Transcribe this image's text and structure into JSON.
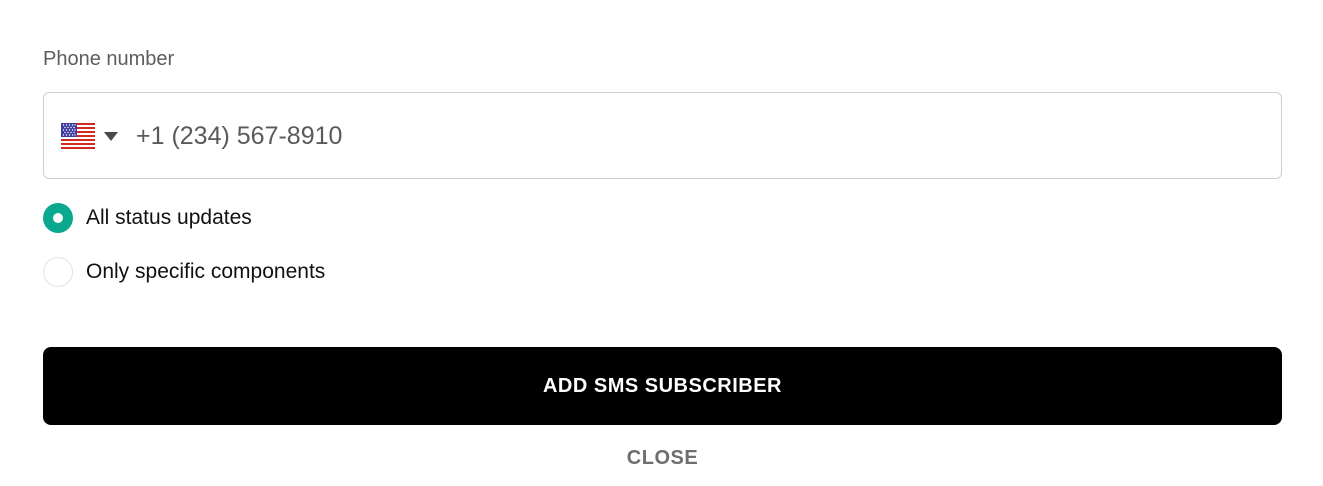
{
  "phone_field": {
    "label": "Phone number",
    "country": {
      "flag_icon": "us-flag-icon",
      "caret_icon": "caret-down-icon"
    },
    "placeholder": "+1 (234) 567-8910",
    "value": ""
  },
  "subscription_options": [
    {
      "label": "All status updates",
      "checked": true
    },
    {
      "label": "Only specific components",
      "checked": false
    }
  ],
  "actions": {
    "submit_label": "ADD SMS SUBSCRIBER",
    "close_label": "CLOSE"
  },
  "colors": {
    "accent": "#0aa88f",
    "button_bg": "#000000",
    "button_text": "#ffffff",
    "muted_text": "#6e6e6e"
  }
}
